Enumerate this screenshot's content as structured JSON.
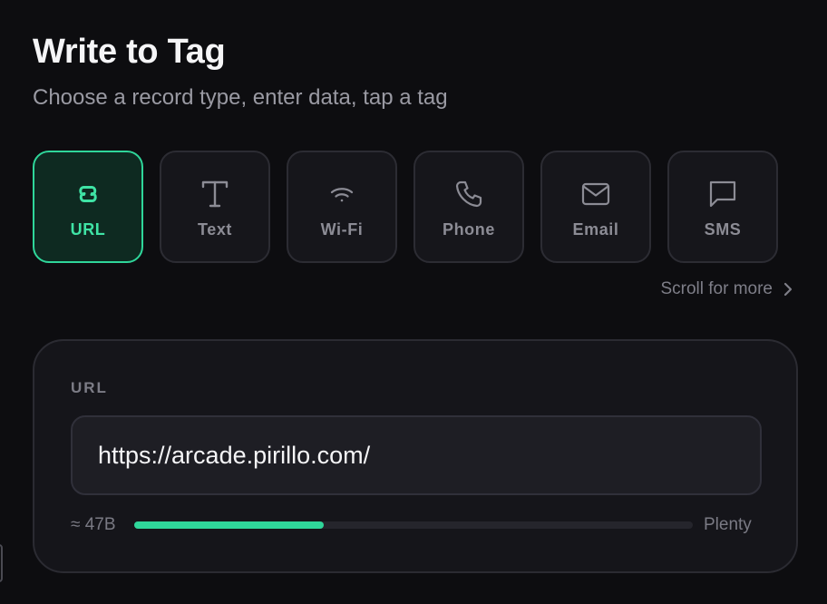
{
  "header": {
    "title": "Write to Tag",
    "subtitle": "Choose a record type, enter data, tap a tag"
  },
  "record_types": [
    {
      "label": "URL",
      "icon": "link-icon",
      "selected": true
    },
    {
      "label": "Text",
      "icon": "text-icon",
      "selected": false
    },
    {
      "label": "Wi-Fi",
      "icon": "wifi-icon",
      "selected": false
    },
    {
      "label": "Phone",
      "icon": "phone-icon",
      "selected": false
    },
    {
      "label": "Email",
      "icon": "envelope-icon",
      "selected": false
    },
    {
      "label": "SMS",
      "icon": "message-icon",
      "selected": false
    }
  ],
  "scroll_hint": "Scroll for more",
  "form": {
    "label": "URL",
    "value": "https://arcade.pirillo.com/"
  },
  "capacity": {
    "size_label": "≈ 47B",
    "fill_fraction": 0.34,
    "status": "Plenty"
  },
  "colors": {
    "accent": "#2fd69a",
    "background": "#0d0d10",
    "card": "#15151a"
  }
}
